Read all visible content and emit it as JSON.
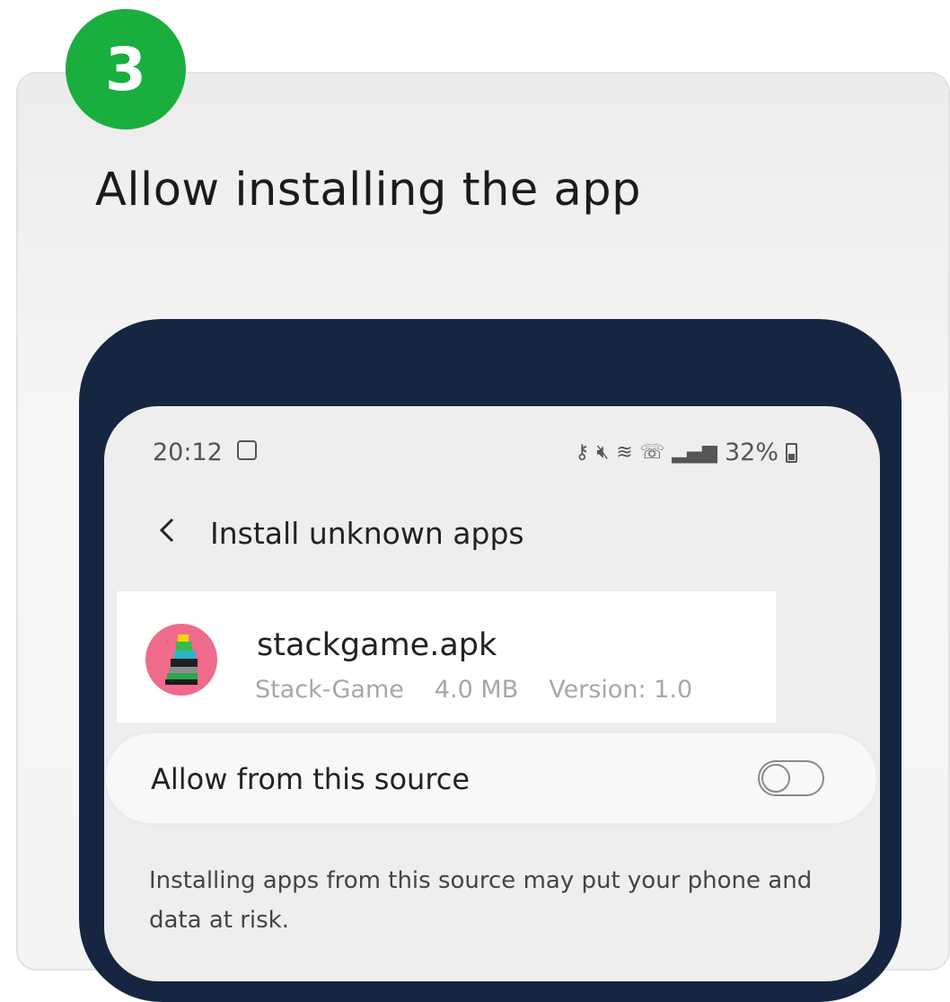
{
  "step": {
    "number": "3",
    "title": "Allow installing the app"
  },
  "status_bar": {
    "time": "20:12",
    "battery_text": "32%",
    "icons": [
      "notification-icon",
      "key-icon",
      "mute-icon",
      "wifi-icon",
      "wifi-calling-icon",
      "signal-icon",
      "battery-icon"
    ]
  },
  "screen": {
    "title": "Install unknown apps",
    "file": {
      "name": "stackgame.apk",
      "app_name": "Stack-Game",
      "size": "4.0 MB",
      "version": "Version: 1.0"
    },
    "toggle": {
      "label": "Allow from this source",
      "enabled": false
    },
    "warning": "Installing apps from this source may put your phone and data at risk."
  },
  "colors": {
    "badge": "#1aae3f",
    "phone_frame": "#162640",
    "app_icon_bg": "#f06b8b"
  }
}
